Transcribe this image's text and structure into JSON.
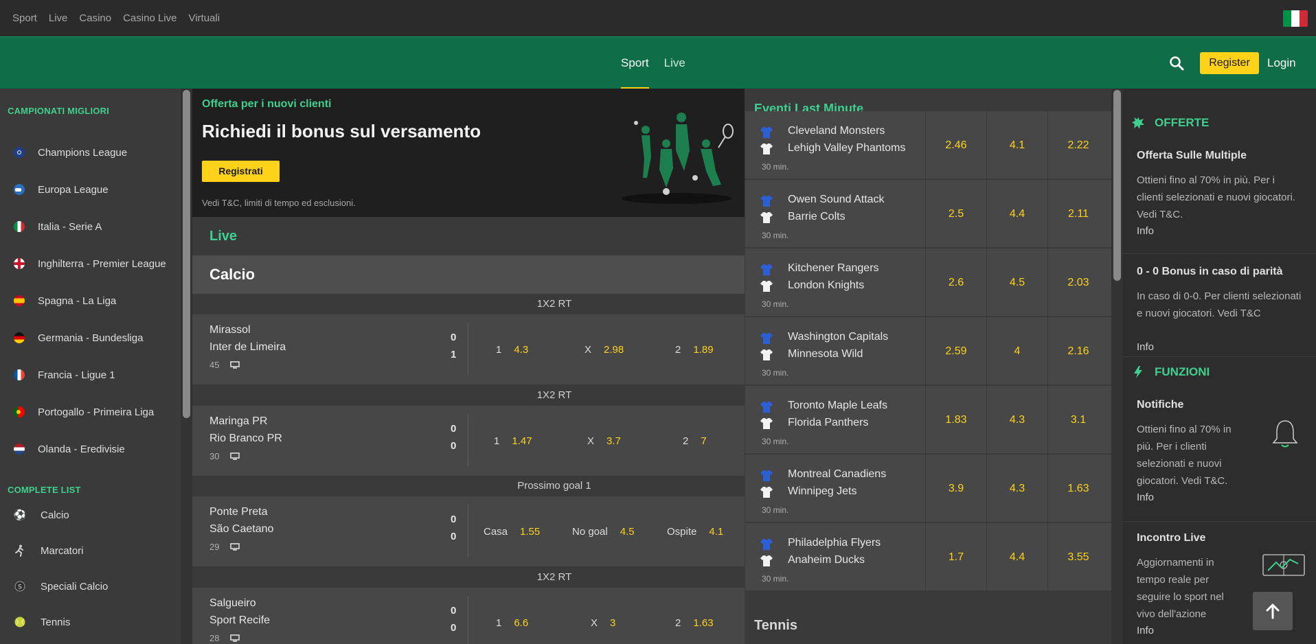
{
  "topnav": [
    "Sport",
    "Live",
    "Casino",
    "Casino Live",
    "Virtuali"
  ],
  "header": {
    "tabs": [
      "Sport",
      "Live"
    ],
    "register": "Register",
    "login": "Login"
  },
  "sidebar": {
    "heading_top": "CAMPIONATI MIGLIORI",
    "leagues": [
      "Champions League",
      "Europa League",
      "Italia - Serie A",
      "Inghilterra - Premier League",
      "Spagna - La Liga",
      "Germania - Bundesliga",
      "Francia - Ligue 1",
      "Portogallo - Primeira Liga",
      "Olanda - Eredivisie"
    ],
    "heading_list": "COMPLETE LIST",
    "list": [
      "Calcio",
      "Marcatori",
      "Speciali Calcio",
      "Tennis"
    ]
  },
  "promo": {
    "label": "Offerta per i nuovi clienti",
    "title": "Richiedi il bonus sul versamento",
    "button": "Registrati",
    "terms": "Vedi T&C, limiti di tempo ed esclusioni."
  },
  "live": {
    "title": "Live",
    "sport": "Calcio",
    "matches": [
      {
        "market": "1X2 RT",
        "home": "Mirassol",
        "away": "Inter de Limeira",
        "score_home": "0",
        "score_away": "1",
        "minute": "45",
        "odds": [
          {
            "label": "1",
            "value": "4.3"
          },
          {
            "label": "X",
            "value": "2.98"
          },
          {
            "label": "2",
            "value": "1.89"
          }
        ]
      },
      {
        "market": "1X2 RT",
        "home": "Maringa PR",
        "away": "Rio Branco PR",
        "score_home": "0",
        "score_away": "0",
        "minute": "30",
        "odds": [
          {
            "label": "1",
            "value": "1.47"
          },
          {
            "label": "X",
            "value": "3.7"
          },
          {
            "label": "2",
            "value": "7"
          }
        ]
      },
      {
        "market": "Prossimo goal 1",
        "home": "Ponte Preta",
        "away": "São Caetano",
        "score_home": "0",
        "score_away": "0",
        "minute": "29",
        "odds": [
          {
            "label": "Casa",
            "value": "1.55"
          },
          {
            "label": "No goal",
            "value": "4.5"
          },
          {
            "label": "Ospite",
            "value": "4.1"
          }
        ]
      },
      {
        "market": "1X2 RT",
        "home": "Salgueiro",
        "away": "Sport Recife",
        "score_home": "0",
        "score_away": "0",
        "minute": "28",
        "odds": [
          {
            "label": "1",
            "value": "6.6"
          },
          {
            "label": "X",
            "value": "3"
          },
          {
            "label": "2",
            "value": "1.63"
          }
        ]
      }
    ]
  },
  "last_minute": {
    "title": "Eventi Last Minute",
    "events": [
      {
        "home": "Cleveland Monsters",
        "away": "Lehigh Valley Phantoms",
        "time": "30 min.",
        "odds": [
          "2.46",
          "4.1",
          "2.22"
        ]
      },
      {
        "home": "Owen Sound Attack",
        "away": "Barrie Colts",
        "time": "30 min.",
        "odds": [
          "2.5",
          "4.4",
          "2.11"
        ]
      },
      {
        "home": "Kitchener Rangers",
        "away": "London Knights",
        "time": "30 min.",
        "odds": [
          "2.6",
          "4.5",
          "2.03"
        ]
      },
      {
        "home": "Washington Capitals",
        "away": "Minnesota Wild",
        "time": "30 min.",
        "odds": [
          "2.59",
          "4",
          "2.16"
        ]
      },
      {
        "home": "Toronto Maple Leafs",
        "away": "Florida Panthers",
        "time": "30 min.",
        "odds": [
          "1.83",
          "4.3",
          "3.1"
        ]
      },
      {
        "home": "Montreal Canadiens",
        "away": "Winnipeg Jets",
        "time": "30 min.",
        "odds": [
          "3.9",
          "4.3",
          "1.63"
        ]
      },
      {
        "home": "Philadelphia Flyers",
        "away": "Anaheim Ducks",
        "time": "30 min.",
        "odds": [
          "1.7",
          "4.4",
          "3.55"
        ]
      }
    ],
    "next_section": "Tennis"
  },
  "right": {
    "offers_title": "OFFERTE",
    "offer1_title": "Offerta Sulle Multiple",
    "offer1_text": "Ottieni fino al 70% in più. Per i clienti selezionati e nuovi giocatori. Vedi T&C.",
    "offer1_info": "Info",
    "offer2_title": "0 - 0 Bonus in caso di parità",
    "offer2_text": "In caso di 0-0. Per clienti selezionati e nuovi giocatori. Vedi T&C",
    "offer2_info": "Info",
    "functions_title": "FUNZIONI",
    "func1_title": "Notifiche",
    "func1_text": "Ottieni fino al 70% in più. Per i clienti selezionati e nuovi giocatori. Vedi T&C.",
    "func1_info": "Info",
    "func2_title": "Incontro Live",
    "func2_text": "Aggiornamenti in tempo reale per seguire lo sport nel vivo dell'azione",
    "func2_info": "Info"
  },
  "colors": {
    "brand_green": "#0f6e47",
    "accent_yellow": "#ffd21a",
    "mint": "#3fd08f"
  }
}
